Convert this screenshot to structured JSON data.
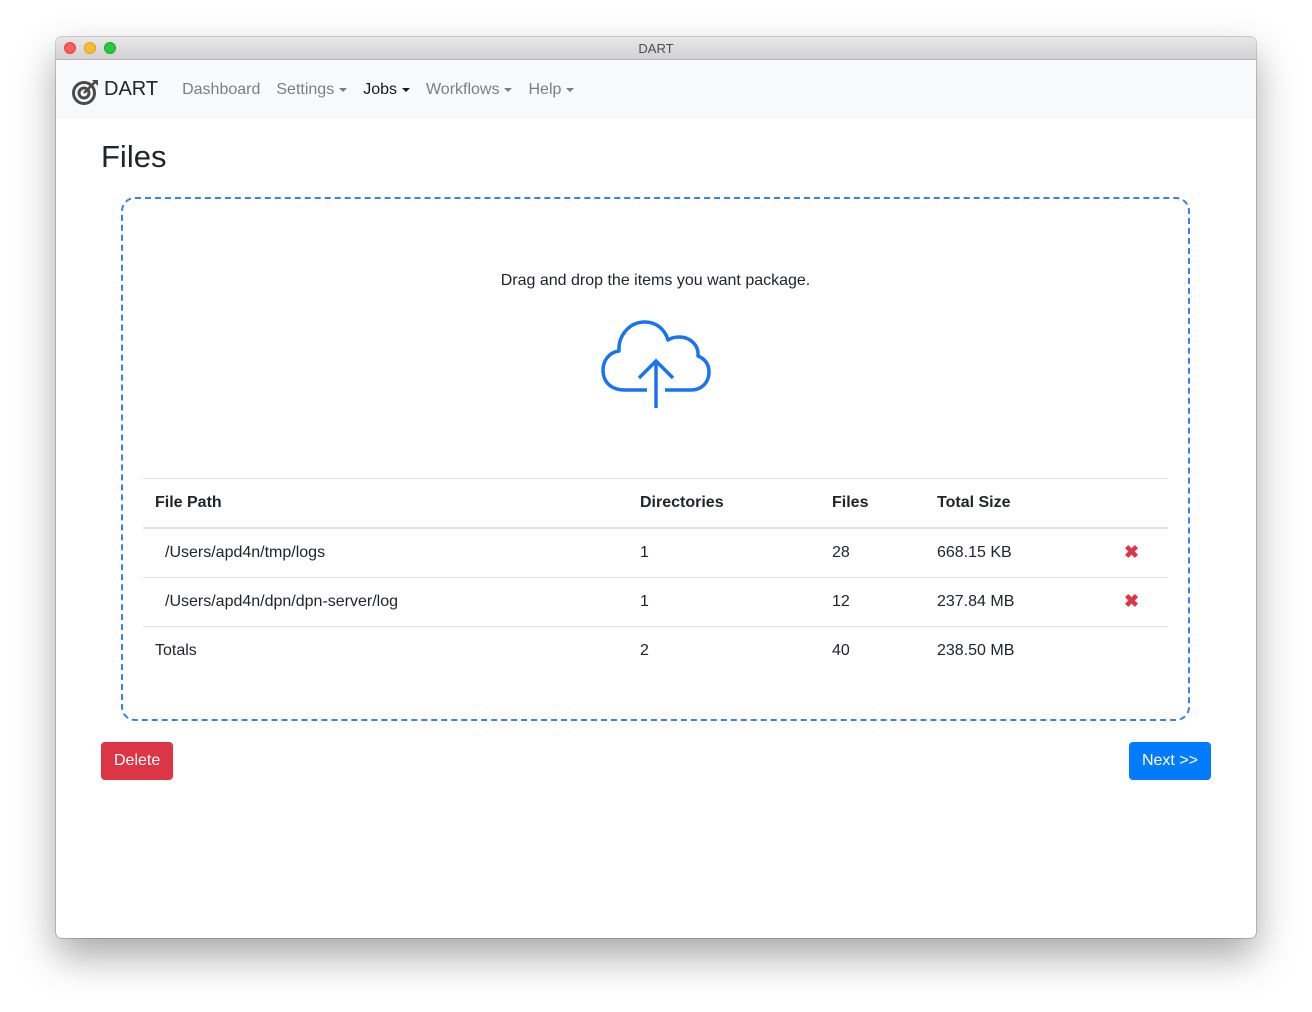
{
  "window": {
    "title": "DART"
  },
  "navbar": {
    "brand": "DART",
    "items": [
      {
        "label": "Dashboard",
        "dropdown": false,
        "active": false
      },
      {
        "label": "Settings",
        "dropdown": true,
        "active": false
      },
      {
        "label": "Jobs",
        "dropdown": true,
        "active": true
      },
      {
        "label": "Workflows",
        "dropdown": true,
        "active": false
      },
      {
        "label": "Help",
        "dropdown": true,
        "active": false
      }
    ]
  },
  "page": {
    "title": "Files",
    "dropzone_text": "Drag and drop the items you want package.",
    "upload_icon": "cloud-upload-icon"
  },
  "table": {
    "headers": [
      "File Path",
      "Directories",
      "Files",
      "Total Size",
      ""
    ],
    "rows": [
      {
        "path": "/Users/apd4n/tmp/logs",
        "directories": "1",
        "files": "28",
        "size": "668.15 KB",
        "remove": "✖"
      },
      {
        "path": "/Users/apd4n/dpn/dpn-server/log",
        "directories": "1",
        "files": "12",
        "size": "237.84 MB",
        "remove": "✖"
      }
    ],
    "totals": {
      "label": "Totals",
      "directories": "2",
      "files": "40",
      "size": "238.50 MB"
    }
  },
  "buttons": {
    "delete": "Delete",
    "next": "Next >>"
  },
  "colors": {
    "accent": "#007bff",
    "danger": "#dc3545",
    "dropzone_border": "#3d7fe3"
  }
}
